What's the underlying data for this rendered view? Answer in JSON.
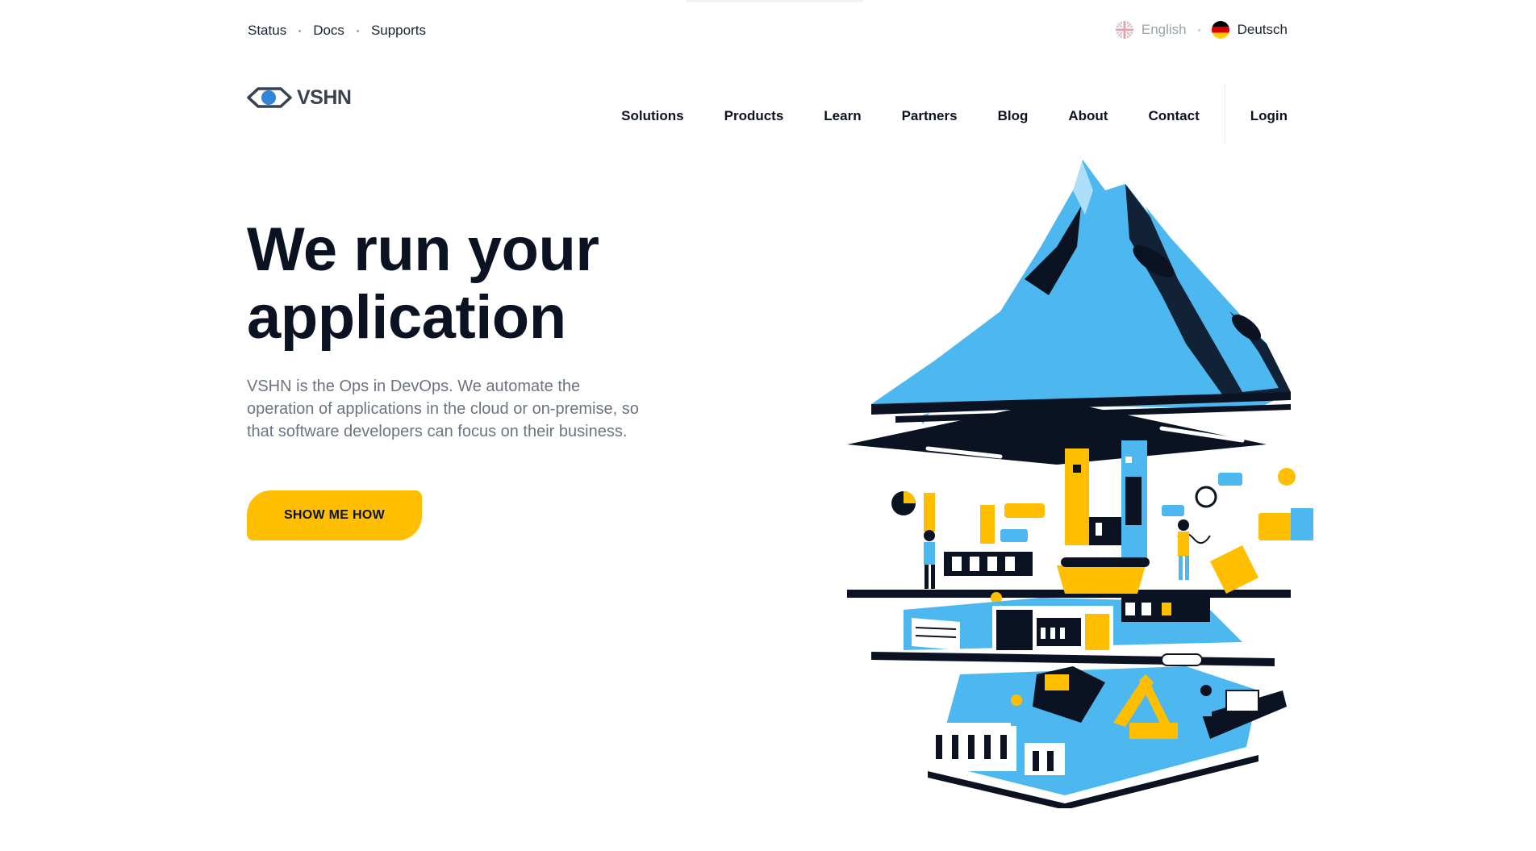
{
  "top_links": {
    "status": "Status",
    "docs": "Docs",
    "supports": "Supports"
  },
  "languages": {
    "english": "English",
    "deutsch": "Deutsch"
  },
  "brand": {
    "name": "VSHN",
    "colors": {
      "accent_yellow": "#ffbf00",
      "sky_blue": "#4db8f0",
      "navy": "#0b1221",
      "logo_blue": "#2f86d6"
    }
  },
  "nav": {
    "solutions": "Solutions",
    "products": "Products",
    "learn": "Learn",
    "partners": "Partners",
    "blog": "Blog",
    "about": "About",
    "contact": "Contact",
    "login": "Login"
  },
  "hero": {
    "title": "We run your application",
    "subtitle": "VSHN is the Ops in DevOps. We automate the operation of applications in the cloud or on-premise, so that software developers can focus on their business.",
    "cta_label": "SHOW ME HOW"
  },
  "icons": {
    "english_flag": "uk-flag-icon",
    "deutsch_flag": "germany-flag-icon",
    "logo": "eye-logo-icon"
  }
}
